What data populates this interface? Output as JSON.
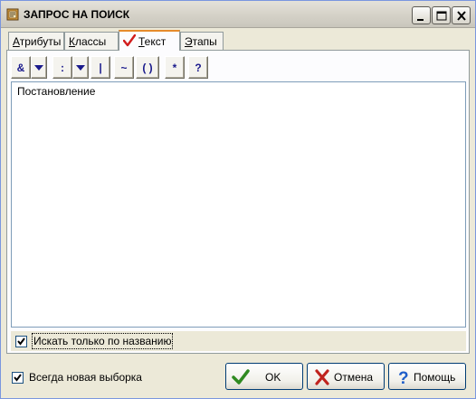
{
  "window": {
    "title": "ЗАПРОС НА ПОИСК"
  },
  "tabs": [
    {
      "label": "Атрибуты",
      "accel": "А",
      "rest": "трибуты"
    },
    {
      "label": "Классы",
      "accel": "К",
      "rest": "лассы"
    },
    {
      "label": "Текст",
      "accel": "Т",
      "rest": "екст"
    },
    {
      "label": "Этапы",
      "accel": "Э",
      "rest": "тапы"
    }
  ],
  "active_tab": "Текст",
  "toolbar": {
    "and": "&",
    "colon": ":",
    "or": "|",
    "tilde": "~",
    "parens": "( )",
    "star": "*",
    "question": "?"
  },
  "editor": {
    "value": "Постановление"
  },
  "options": {
    "name_only_label": "Искать только по названию",
    "name_only_checked": true,
    "always_new_label": "Всегда новая выборка",
    "always_new_checked": true
  },
  "buttons": {
    "ok": "OK",
    "cancel": "Отмена",
    "help": "Помощь"
  },
  "colors": {
    "ok_icon": "#2f8a21",
    "cancel_icon": "#c0231e",
    "help_icon": "#1f5ec9",
    "tab_check": "#d11c1c",
    "toolbar_glyph": "#1a1a8c"
  }
}
